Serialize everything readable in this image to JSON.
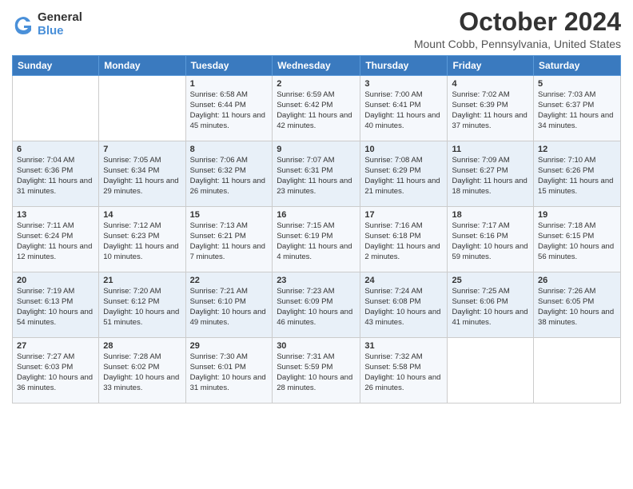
{
  "header": {
    "logo_general": "General",
    "logo_blue": "Blue",
    "month_title": "October 2024",
    "location": "Mount Cobb, Pennsylvania, United States"
  },
  "weekdays": [
    "Sunday",
    "Monday",
    "Tuesday",
    "Wednesday",
    "Thursday",
    "Friday",
    "Saturday"
  ],
  "weeks": [
    [
      {
        "day": "",
        "sunrise": "",
        "sunset": "",
        "daylight": ""
      },
      {
        "day": "",
        "sunrise": "",
        "sunset": "",
        "daylight": ""
      },
      {
        "day": "1",
        "sunrise": "Sunrise: 6:58 AM",
        "sunset": "Sunset: 6:44 PM",
        "daylight": "Daylight: 11 hours and 45 minutes."
      },
      {
        "day": "2",
        "sunrise": "Sunrise: 6:59 AM",
        "sunset": "Sunset: 6:42 PM",
        "daylight": "Daylight: 11 hours and 42 minutes."
      },
      {
        "day": "3",
        "sunrise": "Sunrise: 7:00 AM",
        "sunset": "Sunset: 6:41 PM",
        "daylight": "Daylight: 11 hours and 40 minutes."
      },
      {
        "day": "4",
        "sunrise": "Sunrise: 7:02 AM",
        "sunset": "Sunset: 6:39 PM",
        "daylight": "Daylight: 11 hours and 37 minutes."
      },
      {
        "day": "5",
        "sunrise": "Sunrise: 7:03 AM",
        "sunset": "Sunset: 6:37 PM",
        "daylight": "Daylight: 11 hours and 34 minutes."
      }
    ],
    [
      {
        "day": "6",
        "sunrise": "Sunrise: 7:04 AM",
        "sunset": "Sunset: 6:36 PM",
        "daylight": "Daylight: 11 hours and 31 minutes."
      },
      {
        "day": "7",
        "sunrise": "Sunrise: 7:05 AM",
        "sunset": "Sunset: 6:34 PM",
        "daylight": "Daylight: 11 hours and 29 minutes."
      },
      {
        "day": "8",
        "sunrise": "Sunrise: 7:06 AM",
        "sunset": "Sunset: 6:32 PM",
        "daylight": "Daylight: 11 hours and 26 minutes."
      },
      {
        "day": "9",
        "sunrise": "Sunrise: 7:07 AM",
        "sunset": "Sunset: 6:31 PM",
        "daylight": "Daylight: 11 hours and 23 minutes."
      },
      {
        "day": "10",
        "sunrise": "Sunrise: 7:08 AM",
        "sunset": "Sunset: 6:29 PM",
        "daylight": "Daylight: 11 hours and 21 minutes."
      },
      {
        "day": "11",
        "sunrise": "Sunrise: 7:09 AM",
        "sunset": "Sunset: 6:27 PM",
        "daylight": "Daylight: 11 hours and 18 minutes."
      },
      {
        "day": "12",
        "sunrise": "Sunrise: 7:10 AM",
        "sunset": "Sunset: 6:26 PM",
        "daylight": "Daylight: 11 hours and 15 minutes."
      }
    ],
    [
      {
        "day": "13",
        "sunrise": "Sunrise: 7:11 AM",
        "sunset": "Sunset: 6:24 PM",
        "daylight": "Daylight: 11 hours and 12 minutes."
      },
      {
        "day": "14",
        "sunrise": "Sunrise: 7:12 AM",
        "sunset": "Sunset: 6:23 PM",
        "daylight": "Daylight: 11 hours and 10 minutes."
      },
      {
        "day": "15",
        "sunrise": "Sunrise: 7:13 AM",
        "sunset": "Sunset: 6:21 PM",
        "daylight": "Daylight: 11 hours and 7 minutes."
      },
      {
        "day": "16",
        "sunrise": "Sunrise: 7:15 AM",
        "sunset": "Sunset: 6:19 PM",
        "daylight": "Daylight: 11 hours and 4 minutes."
      },
      {
        "day": "17",
        "sunrise": "Sunrise: 7:16 AM",
        "sunset": "Sunset: 6:18 PM",
        "daylight": "Daylight: 11 hours and 2 minutes."
      },
      {
        "day": "18",
        "sunrise": "Sunrise: 7:17 AM",
        "sunset": "Sunset: 6:16 PM",
        "daylight": "Daylight: 10 hours and 59 minutes."
      },
      {
        "day": "19",
        "sunrise": "Sunrise: 7:18 AM",
        "sunset": "Sunset: 6:15 PM",
        "daylight": "Daylight: 10 hours and 56 minutes."
      }
    ],
    [
      {
        "day": "20",
        "sunrise": "Sunrise: 7:19 AM",
        "sunset": "Sunset: 6:13 PM",
        "daylight": "Daylight: 10 hours and 54 minutes."
      },
      {
        "day": "21",
        "sunrise": "Sunrise: 7:20 AM",
        "sunset": "Sunset: 6:12 PM",
        "daylight": "Daylight: 10 hours and 51 minutes."
      },
      {
        "day": "22",
        "sunrise": "Sunrise: 7:21 AM",
        "sunset": "Sunset: 6:10 PM",
        "daylight": "Daylight: 10 hours and 49 minutes."
      },
      {
        "day": "23",
        "sunrise": "Sunrise: 7:23 AM",
        "sunset": "Sunset: 6:09 PM",
        "daylight": "Daylight: 10 hours and 46 minutes."
      },
      {
        "day": "24",
        "sunrise": "Sunrise: 7:24 AM",
        "sunset": "Sunset: 6:08 PM",
        "daylight": "Daylight: 10 hours and 43 minutes."
      },
      {
        "day": "25",
        "sunrise": "Sunrise: 7:25 AM",
        "sunset": "Sunset: 6:06 PM",
        "daylight": "Daylight: 10 hours and 41 minutes."
      },
      {
        "day": "26",
        "sunrise": "Sunrise: 7:26 AM",
        "sunset": "Sunset: 6:05 PM",
        "daylight": "Daylight: 10 hours and 38 minutes."
      }
    ],
    [
      {
        "day": "27",
        "sunrise": "Sunrise: 7:27 AM",
        "sunset": "Sunset: 6:03 PM",
        "daylight": "Daylight: 10 hours and 36 minutes."
      },
      {
        "day": "28",
        "sunrise": "Sunrise: 7:28 AM",
        "sunset": "Sunset: 6:02 PM",
        "daylight": "Daylight: 10 hours and 33 minutes."
      },
      {
        "day": "29",
        "sunrise": "Sunrise: 7:30 AM",
        "sunset": "Sunset: 6:01 PM",
        "daylight": "Daylight: 10 hours and 31 minutes."
      },
      {
        "day": "30",
        "sunrise": "Sunrise: 7:31 AM",
        "sunset": "Sunset: 5:59 PM",
        "daylight": "Daylight: 10 hours and 28 minutes."
      },
      {
        "day": "31",
        "sunrise": "Sunrise: 7:32 AM",
        "sunset": "Sunset: 5:58 PM",
        "daylight": "Daylight: 10 hours and 26 minutes."
      },
      {
        "day": "",
        "sunrise": "",
        "sunset": "",
        "daylight": ""
      },
      {
        "day": "",
        "sunrise": "",
        "sunset": "",
        "daylight": ""
      }
    ]
  ]
}
